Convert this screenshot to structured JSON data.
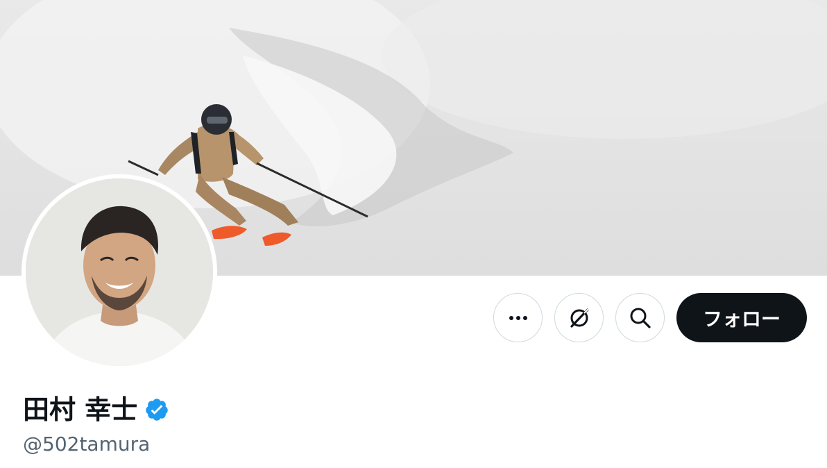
{
  "profile": {
    "display_name": "田村 幸士",
    "handle": "@502tamura",
    "verified": true,
    "banner_alt": "skier in tan jacket carving through powder snow",
    "avatar_alt": "smiling man with dark hair in white t-shirt"
  },
  "actions": {
    "more_icon": "more-dots-icon",
    "grok_icon": "grok-icon",
    "search_icon": "search-icon",
    "follow_label": "フォロー"
  },
  "colors": {
    "follow_bg": "#0f1419",
    "verified_blue": "#1d9bf0",
    "handle_gray": "#536471",
    "border": "#cfd9de"
  }
}
